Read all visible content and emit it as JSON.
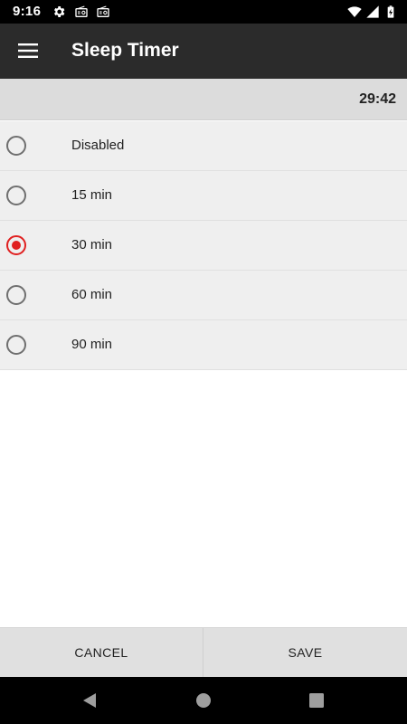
{
  "status_bar": {
    "time": "9:16",
    "icons": [
      "settings-gear-icon",
      "radio-icon",
      "radio-icon",
      "wifi-icon",
      "cellular-signal-icon",
      "battery-charging-icon"
    ]
  },
  "app_bar": {
    "menu_icon": "hamburger-menu-icon",
    "title": "Sleep Timer"
  },
  "remaining": {
    "time": "29:42"
  },
  "options": [
    {
      "label": "Disabled",
      "selected": false
    },
    {
      "label": "15 min",
      "selected": false
    },
    {
      "label": "30 min",
      "selected": true
    },
    {
      "label": "60 min",
      "selected": false
    },
    {
      "label": "90 min",
      "selected": false
    }
  ],
  "buttons": {
    "cancel_label": "CANCEL",
    "save_label": "SAVE"
  },
  "nav_bar": {
    "icons": [
      "back-icon",
      "home-icon",
      "recents-icon"
    ]
  },
  "colors": {
    "accent": "#e02020",
    "app_bar": "#2b2b2b",
    "list_bg": "#efefef"
  }
}
